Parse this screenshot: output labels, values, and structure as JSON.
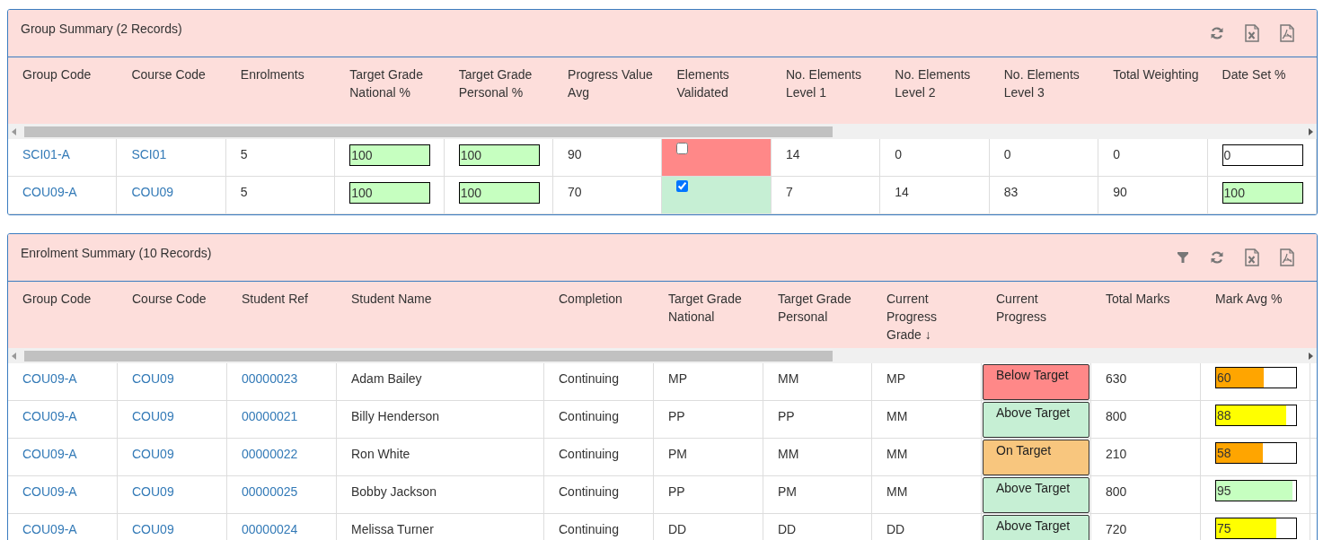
{
  "panels": [
    {
      "title": "Group Summary (2 Records)",
      "toolbar": [
        {
          "kind": "refresh"
        },
        {
          "kind": "excel"
        },
        {
          "kind": "pdf"
        }
      ],
      "columns": [
        "Group Code",
        "Course Code",
        "Enrolments",
        "Target Grade National %",
        "Target Grade Personal %",
        "Progress Value Avg",
        "Elements Validated",
        "No. Elements Level 1",
        "No. Elements Level 2",
        "No. Elements Level 3",
        "Total Weighting",
        "Date Set %"
      ],
      "rows": [
        {
          "cells": [
            {
              "kind": "link",
              "text": "SCI01-A"
            },
            {
              "kind": "link",
              "text": "SCI01"
            },
            {
              "kind": "text",
              "text": "5"
            },
            {
              "kind": "input",
              "value": "100",
              "highlighted": true
            },
            {
              "kind": "input",
              "value": "100",
              "highlighted": true
            },
            {
              "kind": "text",
              "text": "90"
            },
            {
              "kind": "checkbox",
              "checked": false
            },
            {
              "kind": "text",
              "text": "14"
            },
            {
              "kind": "text",
              "text": "0"
            },
            {
              "kind": "text",
              "text": "0"
            },
            {
              "kind": "text",
              "text": "0"
            },
            {
              "kind": "input",
              "value": "0",
              "highlighted": false
            }
          ]
        },
        {
          "cells": [
            {
              "kind": "link",
              "text": "COU09-A"
            },
            {
              "kind": "link",
              "text": "COU09"
            },
            {
              "kind": "text",
              "text": "5"
            },
            {
              "kind": "input",
              "value": "100",
              "highlighted": true
            },
            {
              "kind": "input",
              "value": "100",
              "highlighted": true
            },
            {
              "kind": "text",
              "text": "70"
            },
            {
              "kind": "checkbox",
              "checked": true
            },
            {
              "kind": "text",
              "text": "7"
            },
            {
              "kind": "text",
              "text": "14"
            },
            {
              "kind": "text",
              "text": "83"
            },
            {
              "kind": "text",
              "text": "90"
            },
            {
              "kind": "input",
              "value": "100",
              "highlighted": true
            }
          ]
        }
      ]
    },
    {
      "title": "Enrolment Summary (10 Records)",
      "toolbar": [
        {
          "kind": "filter"
        },
        {
          "kind": "refresh"
        },
        {
          "kind": "excel"
        },
        {
          "kind": "pdf"
        }
      ],
      "columns": [
        "Group Code",
        "Course Code",
        "Student Ref",
        "Student Name",
        "Completion",
        "Target Grade National",
        "Target Grade Personal",
        "Current Progress Grade ↓",
        "Current Progress",
        "Total Marks",
        "Mark Avg %"
      ],
      "rows": [
        {
          "cells": [
            {
              "kind": "link",
              "text": "COU09-A"
            },
            {
              "kind": "link",
              "text": "COU09"
            },
            {
              "kind": "link",
              "text": "00000023"
            },
            {
              "kind": "text",
              "text": "Adam Bailey"
            },
            {
              "kind": "text",
              "text": "Continuing"
            },
            {
              "kind": "text",
              "text": "MP"
            },
            {
              "kind": "text",
              "text": "MM"
            },
            {
              "kind": "text",
              "text": "MP"
            },
            {
              "kind": "status",
              "text": "Below Target",
              "color": "#ff8888"
            },
            {
              "kind": "text",
              "text": "630"
            },
            {
              "kind": "bar",
              "reading": "60",
              "level": 0.6,
              "color": "#ffa500"
            }
          ]
        },
        {
          "cells": [
            {
              "kind": "link",
              "text": "COU09-A"
            },
            {
              "kind": "link",
              "text": "COU09"
            },
            {
              "kind": "link",
              "text": "00000021"
            },
            {
              "kind": "text",
              "text": "Billy Henderson"
            },
            {
              "kind": "text",
              "text": "Continuing"
            },
            {
              "kind": "text",
              "text": "PP"
            },
            {
              "kind": "text",
              "text": "PP"
            },
            {
              "kind": "text",
              "text": "MM"
            },
            {
              "kind": "status",
              "text": "Above Target",
              "color": "#c6efd4"
            },
            {
              "kind": "text",
              "text": "800"
            },
            {
              "kind": "bar",
              "reading": "88",
              "level": 0.88,
              "color": "#ffff00"
            }
          ]
        },
        {
          "cells": [
            {
              "kind": "link",
              "text": "COU09-A"
            },
            {
              "kind": "link",
              "text": "COU09"
            },
            {
              "kind": "link",
              "text": "00000022"
            },
            {
              "kind": "text",
              "text": "Ron White"
            },
            {
              "kind": "text",
              "text": "Continuing"
            },
            {
              "kind": "text",
              "text": "PM"
            },
            {
              "kind": "text",
              "text": "MM"
            },
            {
              "kind": "text",
              "text": "MM"
            },
            {
              "kind": "status",
              "text": "On Target",
              "color": "#f8c67e"
            },
            {
              "kind": "text",
              "text": "210"
            },
            {
              "kind": "bar",
              "reading": "58",
              "level": 0.58,
              "color": "#ffa500"
            }
          ]
        },
        {
          "cells": [
            {
              "kind": "link",
              "text": "COU09-A"
            },
            {
              "kind": "link",
              "text": "COU09"
            },
            {
              "kind": "link",
              "text": "00000025"
            },
            {
              "kind": "text",
              "text": "Bobby Jackson"
            },
            {
              "kind": "text",
              "text": "Continuing"
            },
            {
              "kind": "text",
              "text": "PP"
            },
            {
              "kind": "text",
              "text": "PM"
            },
            {
              "kind": "text",
              "text": "MM"
            },
            {
              "kind": "status",
              "text": "Above Target",
              "color": "#c6efd4"
            },
            {
              "kind": "text",
              "text": "800"
            },
            {
              "kind": "bar",
              "reading": "95",
              "level": 0.95,
              "color": "#c6ffc0"
            }
          ]
        },
        {
          "cells": [
            {
              "kind": "link",
              "text": "COU09-A"
            },
            {
              "kind": "link",
              "text": "COU09"
            },
            {
              "kind": "link",
              "text": "00000024"
            },
            {
              "kind": "text",
              "text": "Melissa Turner"
            },
            {
              "kind": "text",
              "text": "Continuing"
            },
            {
              "kind": "text",
              "text": "DD"
            },
            {
              "kind": "text",
              "text": "DD"
            },
            {
              "kind": "text",
              "text": "DD"
            },
            {
              "kind": "status",
              "text": "Above Target",
              "color": "#c6efd4"
            },
            {
              "kind": "text",
              "text": "720"
            },
            {
              "kind": "bar",
              "reading": "75",
              "level": 0.75,
              "color": "#ffff00"
            }
          ]
        }
      ]
    }
  ]
}
